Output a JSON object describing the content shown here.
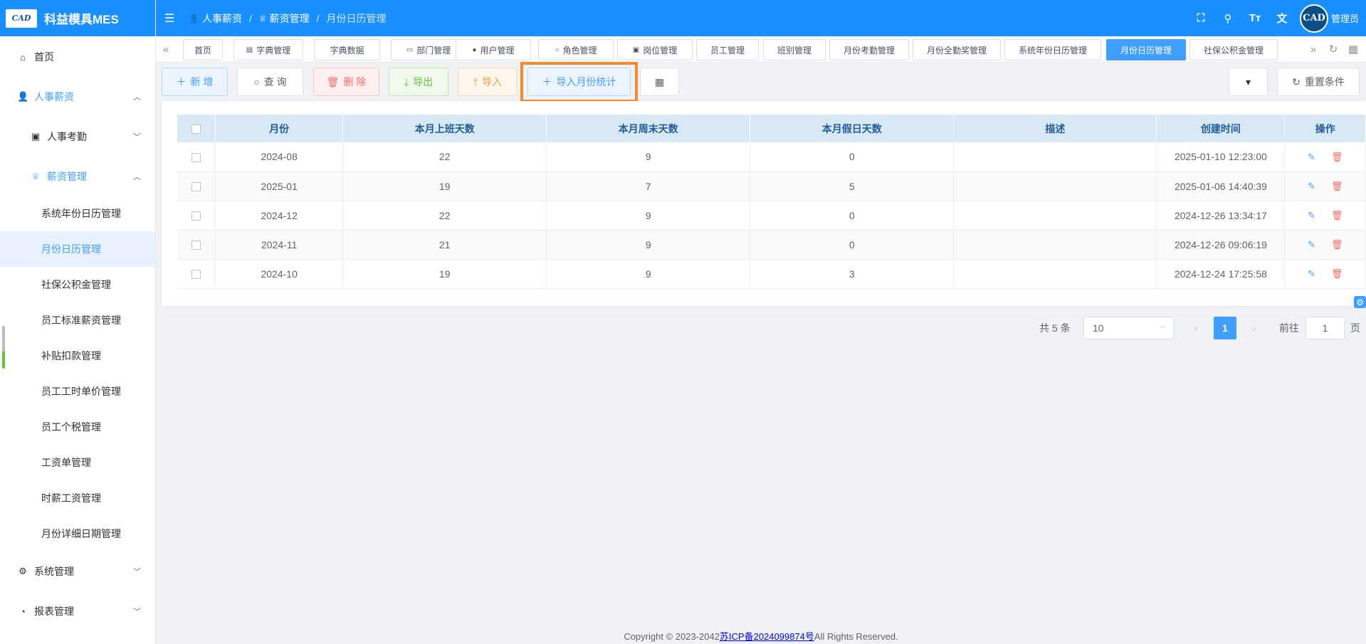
{
  "app": {
    "title": "科益模具MES",
    "logo_text": "CAD"
  },
  "sidebar": {
    "items": [
      {
        "label": "首页"
      },
      {
        "label": "人事薪资"
      },
      {
        "label": "人事考勤"
      },
      {
        "label": "薪资管理"
      },
      {
        "label": "系统年份日历管理"
      },
      {
        "label": "月份日历管理"
      },
      {
        "label": "社保公积金管理"
      },
      {
        "label": "员工标准薪资管理"
      },
      {
        "label": "补贴扣款管理"
      },
      {
        "label": "员工工时单价管理"
      },
      {
        "label": "员工个税管理"
      },
      {
        "label": "工资单管理"
      },
      {
        "label": "时薪工资管理"
      },
      {
        "label": "月份详细日期管理"
      },
      {
        "label": "系统管理"
      },
      {
        "label": "报表管理"
      }
    ]
  },
  "header": {
    "breadcrumb": [
      "人事薪资",
      "薪资管理",
      "月份日历管理"
    ],
    "user": {
      "avatar_text": "CAD",
      "name": "管理员"
    }
  },
  "tabs": [
    {
      "label": "首页"
    },
    {
      "label": "字典管理"
    },
    {
      "label": "字典数据"
    },
    {
      "label": "部门管理"
    },
    {
      "label": "用户管理"
    },
    {
      "label": "角色管理"
    },
    {
      "label": "岗位管理"
    },
    {
      "label": "员工管理"
    },
    {
      "label": "班别管理"
    },
    {
      "label": "月份考勤管理"
    },
    {
      "label": "月份全勤奖管理"
    },
    {
      "label": "系统年份日历管理"
    },
    {
      "label": "月份日历管理"
    },
    {
      "label": "社保公积金管理"
    }
  ],
  "toolbar": {
    "add": "新 增",
    "query": "查 询",
    "delete": "删 除",
    "export": "导出",
    "import": "导入",
    "import_month": "导入月份统计",
    "reset": "重置条件"
  },
  "table": {
    "columns": [
      "月份",
      "本月上班天数",
      "本月周末天数",
      "本月假日天数",
      "描述",
      "创建时间",
      "操作"
    ],
    "rows": [
      {
        "month": "2024-08",
        "work": "22",
        "weekend": "9",
        "holiday": "0",
        "desc": "",
        "created": "2025-01-10 12:23:00"
      },
      {
        "month": "2025-01",
        "work": "19",
        "weekend": "7",
        "holiday": "5",
        "desc": "",
        "created": "2025-01-06 14:40:39"
      },
      {
        "month": "2024-12",
        "work": "22",
        "weekend": "9",
        "holiday": "0",
        "desc": "",
        "created": "2024-12-26 13:34:17"
      },
      {
        "month": "2024-11",
        "work": "21",
        "weekend": "9",
        "holiday": "0",
        "desc": "",
        "created": "2024-12-26 09:06:19"
      },
      {
        "month": "2024-10",
        "work": "19",
        "weekend": "9",
        "holiday": "3",
        "desc": "",
        "created": "2024-12-24 17:25:58"
      }
    ]
  },
  "pagination": {
    "total": "共 5 条",
    "page_size": "10",
    "current": "1",
    "goto_label": "前往",
    "goto_value": "1",
    "page_suffix": "页"
  },
  "footer": {
    "prefix": "Copyright © 2023-2042",
    "icp": "苏ICP备2024099874号",
    "suffix": "All Rights Reserved."
  },
  "colors": {
    "primary": "#1890ff",
    "accent": "#409eff",
    "highlight": "#f28a2e"
  }
}
